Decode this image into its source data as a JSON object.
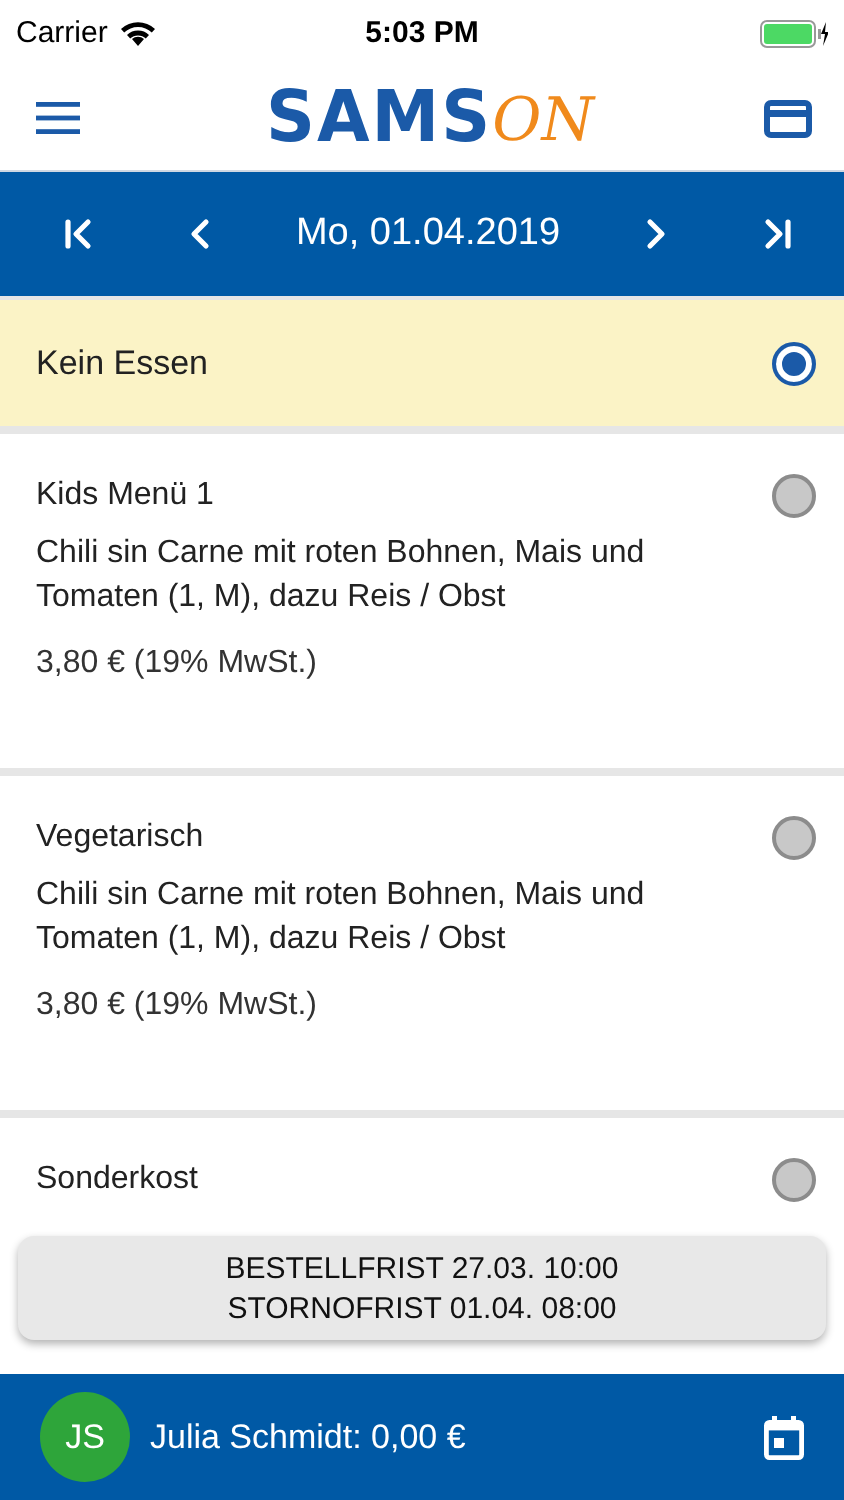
{
  "status_bar": {
    "carrier": "Carrier",
    "time": "5:03 PM"
  },
  "header": {
    "logo_main": "SAMS",
    "logo_accent": "ON"
  },
  "date_bar": {
    "date": "Mo, 01.04.2019"
  },
  "options": [
    {
      "kind": "none",
      "title": "Kein Essen",
      "selected": true
    },
    {
      "kind": "menu",
      "title": "Kids Menü 1",
      "description": "Chili sin Carne mit roten Bohnen, Mais und Tomaten (1, M), dazu Reis / Obst",
      "price": "3,80 € (19% MwSt.)",
      "selected": false
    },
    {
      "kind": "menu",
      "title": "Vegetarisch",
      "description": "Chili sin Carne mit roten Bohnen, Mais und Tomaten (1, M), dazu Reis / Obst",
      "price": "3,80 € (19% MwSt.)",
      "selected": false
    },
    {
      "kind": "menu",
      "title": "Sonderkost",
      "selected": false
    }
  ],
  "deadlines": [
    "BESTELLFRIST 27.03. 10:00",
    "STORNOFRIST 01.04. 08:00"
  ],
  "footer": {
    "initials": "JS",
    "account": "Julia Schmidt: 0,00 €"
  }
}
